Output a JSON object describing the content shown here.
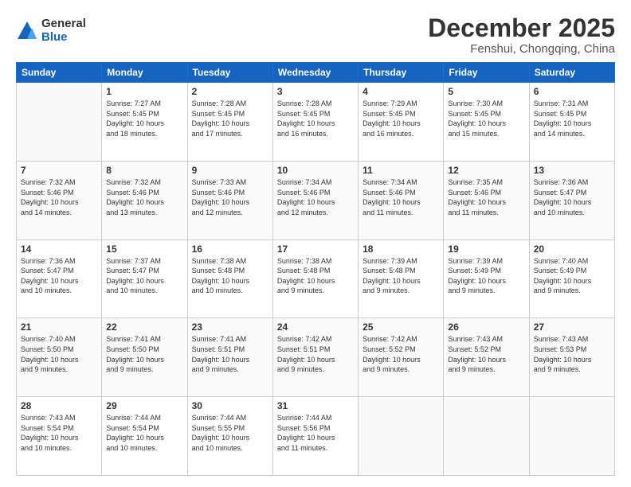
{
  "logo": {
    "general": "General",
    "blue": "Blue"
  },
  "title": "December 2025",
  "subtitle": "Fenshui, Chongqing, China",
  "days": [
    "Sunday",
    "Monday",
    "Tuesday",
    "Wednesday",
    "Thursday",
    "Friday",
    "Saturday"
  ],
  "weeks": [
    [
      {
        "num": "",
        "info": ""
      },
      {
        "num": "1",
        "info": "Sunrise: 7:27 AM\nSunset: 5:45 PM\nDaylight: 10 hours\nand 18 minutes."
      },
      {
        "num": "2",
        "info": "Sunrise: 7:28 AM\nSunset: 5:45 PM\nDaylight: 10 hours\nand 17 minutes."
      },
      {
        "num": "3",
        "info": "Sunrise: 7:28 AM\nSunset: 5:45 PM\nDaylight: 10 hours\nand 16 minutes."
      },
      {
        "num": "4",
        "info": "Sunrise: 7:29 AM\nSunset: 5:45 PM\nDaylight: 10 hours\nand 16 minutes."
      },
      {
        "num": "5",
        "info": "Sunrise: 7:30 AM\nSunset: 5:45 PM\nDaylight: 10 hours\nand 15 minutes."
      },
      {
        "num": "6",
        "info": "Sunrise: 7:31 AM\nSunset: 5:45 PM\nDaylight: 10 hours\nand 14 minutes."
      }
    ],
    [
      {
        "num": "7",
        "info": "Sunrise: 7:32 AM\nSunset: 5:46 PM\nDaylight: 10 hours\nand 14 minutes."
      },
      {
        "num": "8",
        "info": "Sunrise: 7:32 AM\nSunset: 5:46 PM\nDaylight: 10 hours\nand 13 minutes."
      },
      {
        "num": "9",
        "info": "Sunrise: 7:33 AM\nSunset: 5:46 PM\nDaylight: 10 hours\nand 12 minutes."
      },
      {
        "num": "10",
        "info": "Sunrise: 7:34 AM\nSunset: 5:46 PM\nDaylight: 10 hours\nand 12 minutes."
      },
      {
        "num": "11",
        "info": "Sunrise: 7:34 AM\nSunset: 5:46 PM\nDaylight: 10 hours\nand 11 minutes."
      },
      {
        "num": "12",
        "info": "Sunrise: 7:35 AM\nSunset: 5:46 PM\nDaylight: 10 hours\nand 11 minutes."
      },
      {
        "num": "13",
        "info": "Sunrise: 7:36 AM\nSunset: 5:47 PM\nDaylight: 10 hours\nand 10 minutes."
      }
    ],
    [
      {
        "num": "14",
        "info": "Sunrise: 7:36 AM\nSunset: 5:47 PM\nDaylight: 10 hours\nand 10 minutes."
      },
      {
        "num": "15",
        "info": "Sunrise: 7:37 AM\nSunset: 5:47 PM\nDaylight: 10 hours\nand 10 minutes."
      },
      {
        "num": "16",
        "info": "Sunrise: 7:38 AM\nSunset: 5:48 PM\nDaylight: 10 hours\nand 10 minutes."
      },
      {
        "num": "17",
        "info": "Sunrise: 7:38 AM\nSunset: 5:48 PM\nDaylight: 10 hours\nand 9 minutes."
      },
      {
        "num": "18",
        "info": "Sunrise: 7:39 AM\nSunset: 5:48 PM\nDaylight: 10 hours\nand 9 minutes."
      },
      {
        "num": "19",
        "info": "Sunrise: 7:39 AM\nSunset: 5:49 PM\nDaylight: 10 hours\nand 9 minutes."
      },
      {
        "num": "20",
        "info": "Sunrise: 7:40 AM\nSunset: 5:49 PM\nDaylight: 10 hours\nand 9 minutes."
      }
    ],
    [
      {
        "num": "21",
        "info": "Sunrise: 7:40 AM\nSunset: 5:50 PM\nDaylight: 10 hours\nand 9 minutes."
      },
      {
        "num": "22",
        "info": "Sunrise: 7:41 AM\nSunset: 5:50 PM\nDaylight: 10 hours\nand 9 minutes."
      },
      {
        "num": "23",
        "info": "Sunrise: 7:41 AM\nSunset: 5:51 PM\nDaylight: 10 hours\nand 9 minutes."
      },
      {
        "num": "24",
        "info": "Sunrise: 7:42 AM\nSunset: 5:51 PM\nDaylight: 10 hours\nand 9 minutes."
      },
      {
        "num": "25",
        "info": "Sunrise: 7:42 AM\nSunset: 5:52 PM\nDaylight: 10 hours\nand 9 minutes."
      },
      {
        "num": "26",
        "info": "Sunrise: 7:43 AM\nSunset: 5:52 PM\nDaylight: 10 hours\nand 9 minutes."
      },
      {
        "num": "27",
        "info": "Sunrise: 7:43 AM\nSunset: 5:53 PM\nDaylight: 10 hours\nand 9 minutes."
      }
    ],
    [
      {
        "num": "28",
        "info": "Sunrise: 7:43 AM\nSunset: 5:54 PM\nDaylight: 10 hours\nand 10 minutes."
      },
      {
        "num": "29",
        "info": "Sunrise: 7:44 AM\nSunset: 5:54 PM\nDaylight: 10 hours\nand 10 minutes."
      },
      {
        "num": "30",
        "info": "Sunrise: 7:44 AM\nSunset: 5:55 PM\nDaylight: 10 hours\nand 10 minutes."
      },
      {
        "num": "31",
        "info": "Sunrise: 7:44 AM\nSunset: 5:56 PM\nDaylight: 10 hours\nand 11 minutes."
      },
      {
        "num": "",
        "info": ""
      },
      {
        "num": "",
        "info": ""
      },
      {
        "num": "",
        "info": ""
      }
    ]
  ]
}
